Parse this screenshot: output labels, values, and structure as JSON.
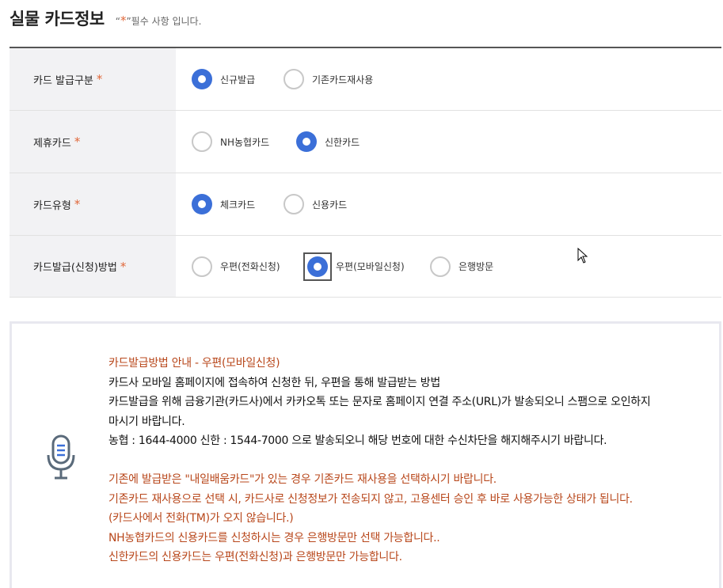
{
  "header": {
    "title": "실물 카드정보",
    "required_note_quote_open": "“",
    "required_note_star": "*",
    "required_note_quote_close": "”",
    "required_note_text": " 필수 사항 입니다."
  },
  "rows": [
    {
      "label": "카드 발급구분",
      "options": [
        {
          "label": "신규발급",
          "checked": true
        },
        {
          "label": "기존카드재사용",
          "checked": false
        }
      ]
    },
    {
      "label": "제휴카드",
      "options": [
        {
          "label": "NH농협카드",
          "checked": false
        },
        {
          "label": "신한카드",
          "checked": true
        }
      ]
    },
    {
      "label": "카드유형",
      "options": [
        {
          "label": "체크카드",
          "checked": true
        },
        {
          "label": "신용카드",
          "checked": false
        }
      ]
    },
    {
      "label": "카드발급(신청)방법",
      "options": [
        {
          "label": "우편(전화신청)",
          "checked": false
        },
        {
          "label": "우편(모바일신청)",
          "checked": true,
          "focused": true
        },
        {
          "label": "은행방문",
          "checked": false
        }
      ]
    }
  ],
  "required_star": "*",
  "info": {
    "icon": "microphone-icon",
    "heading": "카드발급방법 안내 - 우편(모바일신청)",
    "line1": "카드사 모바일 홈페이지에 접속하여 신청한 뒤, 우편을 통해 발급받는 방법",
    "line2": "카드발급을 위해 금융기관(카드사)에서 카카오톡 또는 문자로 홈페이지 연결 주소(URL)가 발송되오니 스팸으로 오인하지",
    "line3": "마시기 바랍니다.",
    "line4": "농협 : 1644-4000 신한 : 1544-7000 으로 발송되오니 해당 번호에 대한 수신차단을 해지해주시기 바랍니다.",
    "note1": "기존에 발급받은 \"내일배움카드\"가 있는 경우 기존카드 재사용을 선택하시기 바랍니다.",
    "note2": "기존카드 재사용으로 선택 시, 카드사로 신청정보가 전송되지 않고, 고용센터 승인 후 바로 사용가능한 상태가 됩니다.",
    "note3": "(카드사에서 전화(TM)가 오지 않습니다.)",
    "note4": "NH농협카드의 신용카드를 신청하시는 경우 은행방문만 선택 가능합니다..",
    "note5": "신한카드의 신용카드는 우편(전화신청)과 은행방문만 가능합니다."
  },
  "colors": {
    "accent_radio": "#3b6fd8",
    "required_star": "#e0683a",
    "notice_orange": "#b8471b",
    "label_bg": "#f2f2f4"
  }
}
